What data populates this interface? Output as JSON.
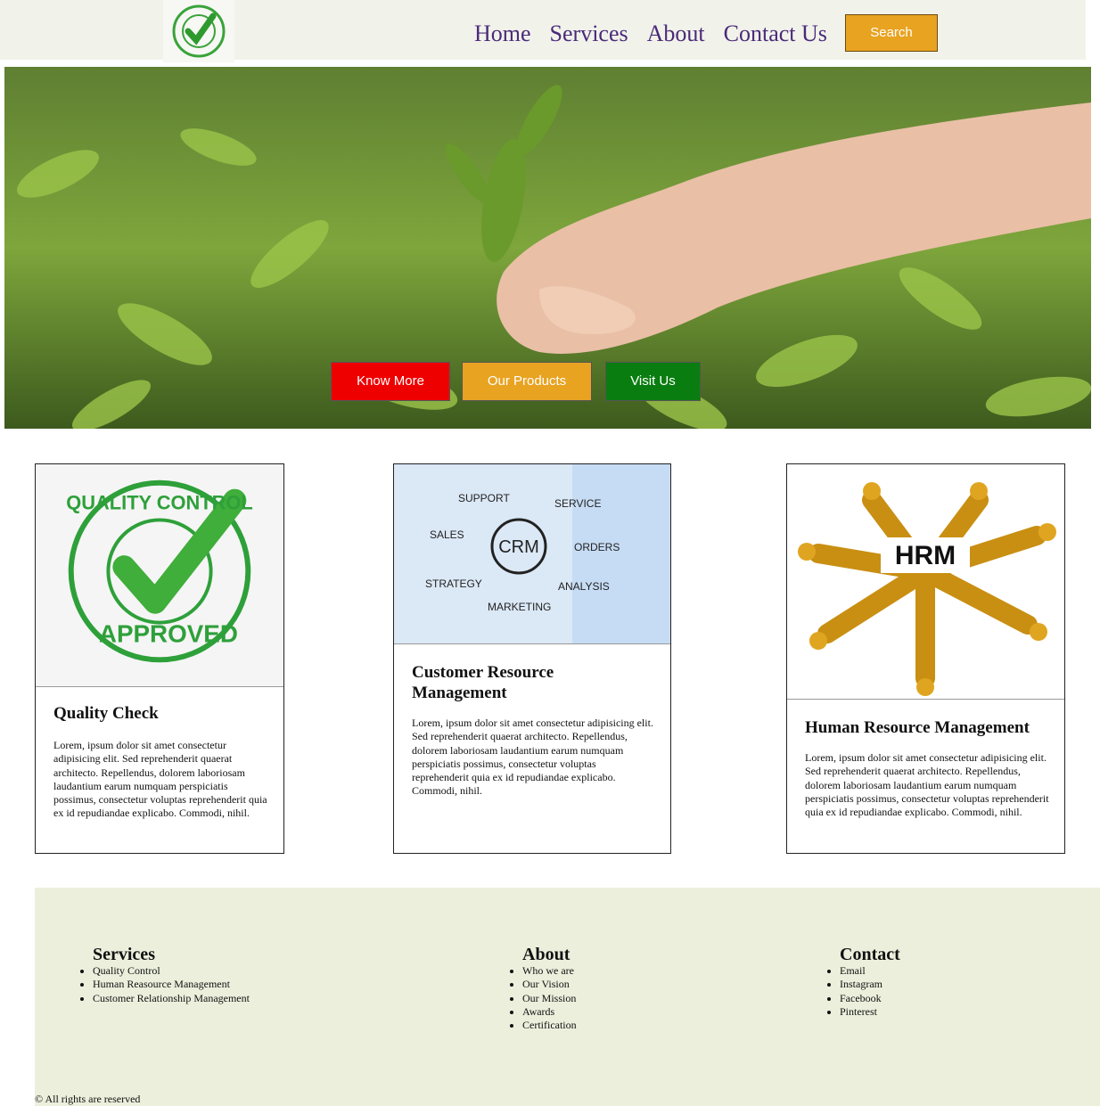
{
  "nav": {
    "logo_alt": "Quality Control Approved",
    "links": [
      "Home",
      "Services",
      "About",
      "Contact Us"
    ],
    "search_label": "Search"
  },
  "hero": {
    "buttons": [
      "Know More",
      "Our Products",
      "Visit Us"
    ]
  },
  "cards": [
    {
      "title": "Quality Check",
      "text": "Lorem, ipsum dolor sit amet consectetur adipisicing elit. Sed reprehenderit quaerat architecto. Repellendus, dolorem laboriosam laudantium earum numquam perspiciatis possimus, consectetur voluptas reprehenderit quia ex id repudiandae explicabo. Commodi, nihil.",
      "stamp_text": "QUALITY CONTROL APPROVED"
    },
    {
      "title": "Customer Resource Management",
      "text": "Lorem, ipsum dolor sit amet consectetur adipisicing elit. Sed reprehenderit quaerat architecto. Repellendus, dolorem laboriosam laudantium earum numquam perspiciatis possimus, consectetur voluptas reprehenderit quia ex id repudiandae explicabo. Commodi, nihil.",
      "diagram": {
        "center": "CRM",
        "labels": [
          "SUPPORT",
          "SERVICE",
          "SALES",
          "ORDERS",
          "STRATEGY",
          "ANALYSIS",
          "MARKETING"
        ]
      }
    },
    {
      "title": "Human Resource Management",
      "text": "Lorem, ipsum dolor sit amet consectetur adipisicing elit. Sed reprehenderit quaerat architecto. Repellendus, dolorem laboriosam laudantium earum numquam perspiciatis possimus, consectetur voluptas reprehenderit quia ex id repudiandae explicabo. Commodi, nihil.",
      "image_text": "HRM"
    }
  ],
  "footer": {
    "columns": [
      {
        "heading": "Services",
        "items": [
          "Quality Control",
          "Human Reasource Management",
          "Customer Relationship Management"
        ]
      },
      {
        "heading": "About",
        "items": [
          "Who we are",
          "Our Vision",
          "Our Mission",
          "Awards",
          "Certification"
        ]
      },
      {
        "heading": "Contact",
        "items": [
          "Email",
          "Instagram",
          "Facebook",
          "Pinterest"
        ]
      }
    ],
    "copyright": "© All rights are reserved"
  },
  "colors": {
    "nav_bg": "#f1f3ea",
    "nav_link": "#4b2a7a",
    "search_bg": "#e8a321",
    "know_more_bg": "#ef0000",
    "products_bg": "#e8a321",
    "visit_bg": "#0a7d10",
    "footer_bg": "#ebefdc"
  }
}
